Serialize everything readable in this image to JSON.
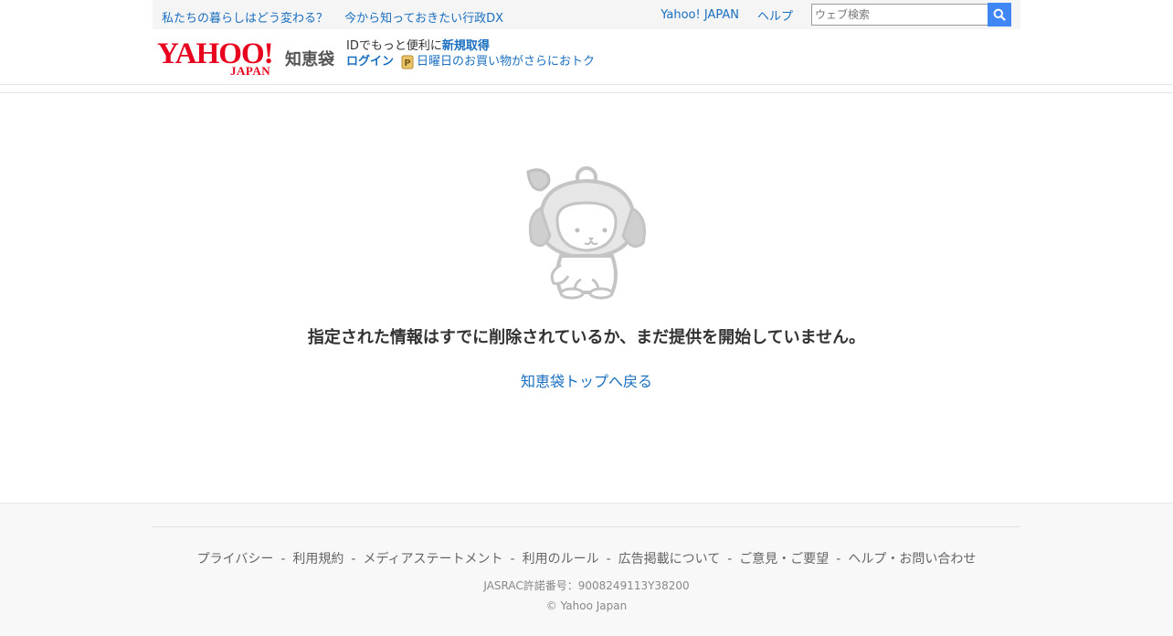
{
  "topbar": {
    "promo_links": [
      "私たちの暮らしはどう変わる？",
      "今から知っておきたい行政DX"
    ],
    "yahoo_japan_link": "Yahoo! JAPAN",
    "help_link": "ヘルプ",
    "search_placeholder": "ウェブ検索"
  },
  "header": {
    "logo_text": "YAHOO!",
    "logo_sub": "JAPAN",
    "service_name": "知恵袋",
    "id_prompt": "IDでもっと便利に",
    "signup_link": "新規取得",
    "login_link": "ログイン",
    "promo_text": "日曜日のお買い物がさらにおトク"
  },
  "main": {
    "error_message": "指定された情報はすでに削除されているか、まだ提供を開始していません。",
    "back_link": "知恵袋トップへ戻る"
  },
  "footer": {
    "links": [
      "プライバシー",
      "利用規約",
      "メディアステートメント",
      "利用のルール",
      "広告掲載について",
      "ご意見・ご要望",
      "ヘルプ・お問い合わせ"
    ],
    "separator": "-",
    "jasrac": "JASRAC許諾番号：9008249113Y38200",
    "copyright": "© Yahoo Japan"
  },
  "colors": {
    "link": "#1a6fc0",
    "brand_red": "#e8001e",
    "search_button": "#3f87f5"
  },
  "icons": [
    "search-icon",
    "paypay-coin-icon",
    "mascot-illustration"
  ]
}
